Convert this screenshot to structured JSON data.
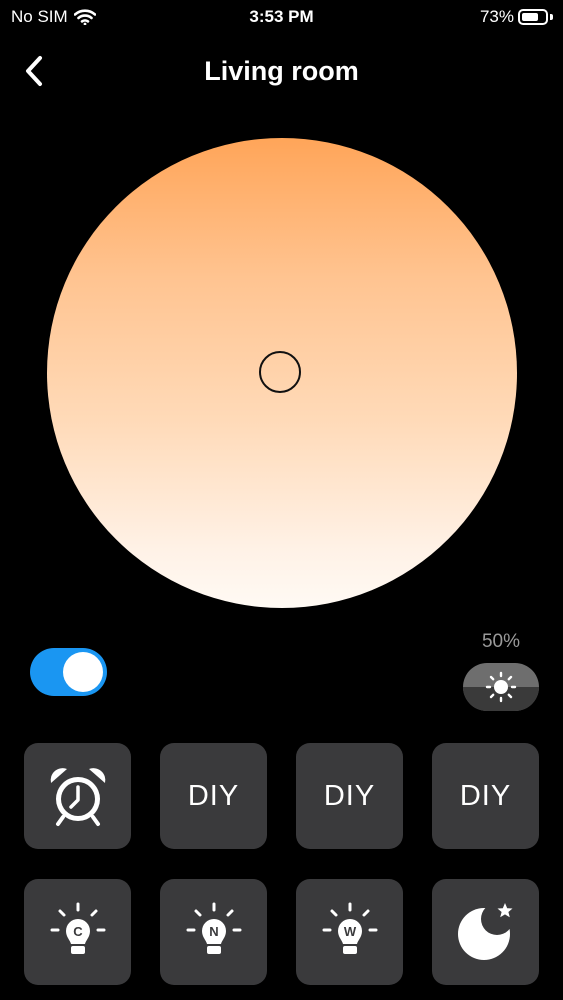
{
  "status": {
    "carrier": "No SIM",
    "time": "3:53 PM",
    "battery": "73%",
    "battery_level": 0.73
  },
  "header": {
    "back_icon": "chevron-left-icon",
    "title": "Living room"
  },
  "color_wheel": {
    "colors": [
      "#ffa559",
      "#ffc491",
      "#ffdab8",
      "#fff2e7",
      "#fffaf4"
    ]
  },
  "power_toggle": {
    "on": true,
    "color": "#1a96f2"
  },
  "brightness": {
    "label": "50%",
    "value": 0.5,
    "icon": "sun-icon"
  },
  "scenes": [
    {
      "icon": "alarm-clock-icon"
    },
    {
      "label": "DIY"
    },
    {
      "label": "DIY"
    },
    {
      "label": "DIY"
    },
    {
      "icon": "bulb-icon",
      "letter": "C"
    },
    {
      "icon": "bulb-icon",
      "letter": "N"
    },
    {
      "icon": "bulb-icon",
      "letter": "W"
    },
    {
      "icon": "moon-star-icon"
    }
  ]
}
